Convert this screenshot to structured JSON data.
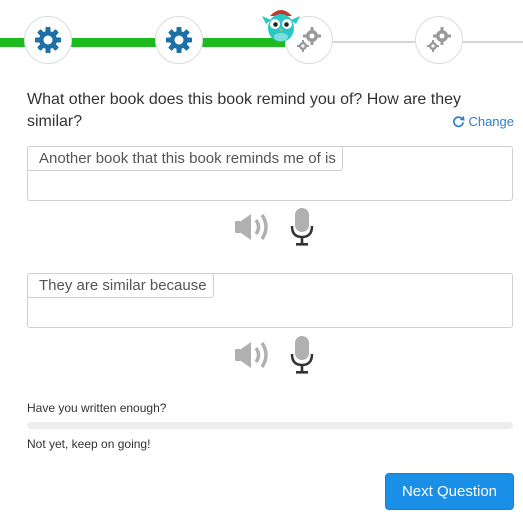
{
  "progress": {
    "steps": [
      {
        "state": "done",
        "icon": "gear-icon"
      },
      {
        "state": "done",
        "icon": "gear-icon"
      },
      {
        "state": "current",
        "icon": "gears-icon"
      },
      {
        "state": "todo",
        "icon": "gears-icon"
      }
    ],
    "mascot_icon": "owl-icon",
    "done_color": "#1dbb1d",
    "gear_color": "#1d6fa8"
  },
  "question": {
    "text": "What other book does this book remind you of? How are they similar?",
    "change_label": "Change"
  },
  "answers": [
    {
      "prompt": "Another book that this book reminds me of is",
      "value": ""
    },
    {
      "prompt": "They are similar because",
      "value": ""
    }
  ],
  "tools": {
    "speaker_icon": "speaker-icon",
    "mic_icon": "microphone-icon"
  },
  "enough": {
    "label": "Have you written enough?",
    "level": 0,
    "status": "Not yet, keep on going!"
  },
  "next_button": {
    "label": "Next Question",
    "color": "#1a8fe8"
  }
}
